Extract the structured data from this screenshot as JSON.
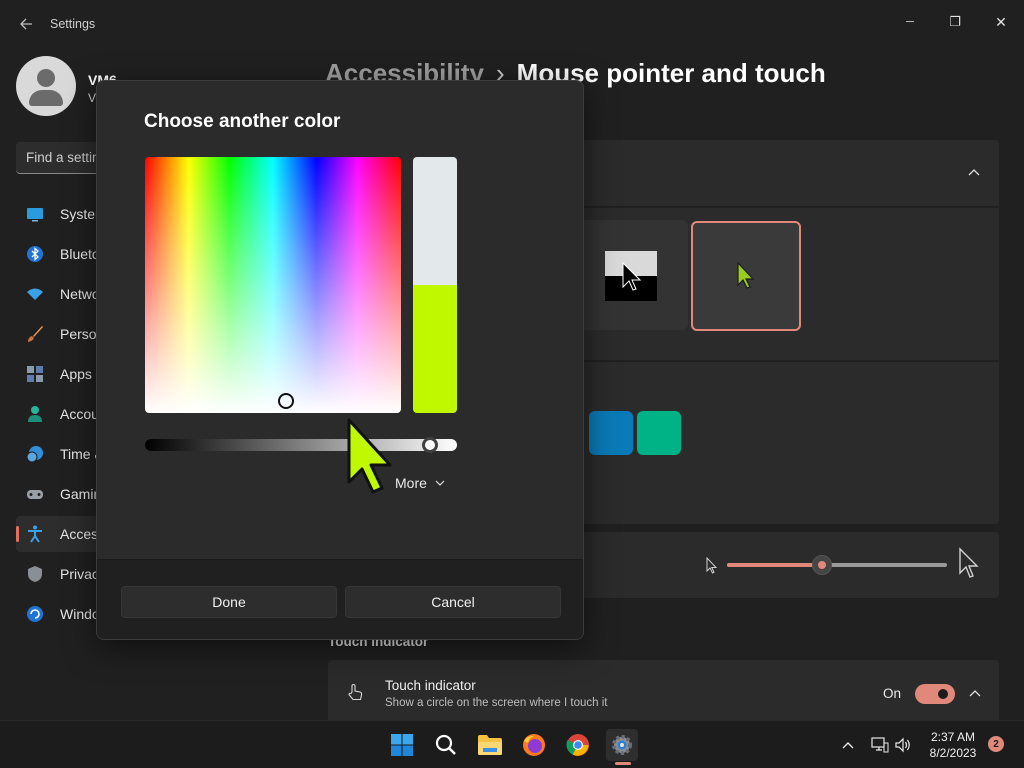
{
  "window": {
    "title": "Settings",
    "controls": {
      "minimize": "─",
      "maximize": "❐",
      "close": "✕"
    }
  },
  "profile": {
    "name": "VM6",
    "subtitle": "V"
  },
  "search": {
    "placeholder": "Find a setting"
  },
  "sidebar": {
    "items": [
      {
        "label": "System",
        "icon": "monitor-icon",
        "active": false
      },
      {
        "label": "Bluetooth & devices",
        "icon": "bluetooth-icon",
        "active": false
      },
      {
        "label": "Network & internet",
        "icon": "wifi-icon",
        "active": false
      },
      {
        "label": "Personalization",
        "icon": "brush-icon",
        "active": false
      },
      {
        "label": "Apps",
        "icon": "apps-icon",
        "active": false
      },
      {
        "label": "Accounts",
        "icon": "person-icon",
        "active": false
      },
      {
        "label": "Time & language",
        "icon": "globe-clock-icon",
        "active": false
      },
      {
        "label": "Gaming",
        "icon": "gamepad-icon",
        "active": false
      },
      {
        "label": "Accessibility",
        "icon": "accessibility-icon",
        "active": true
      },
      {
        "label": "Privacy & security",
        "icon": "shield-icon",
        "active": false
      },
      {
        "label": "Windows Update",
        "icon": "update-icon",
        "active": false
      }
    ]
  },
  "header": {
    "parent": "Accessibility",
    "separator": "›",
    "current": "Mouse pointer and touch"
  },
  "pointer_size": {
    "value_fraction": 0.43
  },
  "touch_section": {
    "title": "Touch indicator",
    "row_title": "Touch indicator",
    "row_desc": "Show a circle on the screen where I touch it",
    "toggle_label": "On",
    "toggle_on": true
  },
  "color_swatches": [
    "#0a7ab8",
    "#00b386"
  ],
  "dialog": {
    "title": "Choose another color",
    "more_label": "More",
    "done_label": "Done",
    "cancel_label": "Cancel",
    "previous_color": "#e3e8ea",
    "new_color": "#c0f800",
    "value_fraction": 0.915
  },
  "taskbar": {
    "apps": [
      "windows-start-icon",
      "search-icon",
      "file-explorer-icon",
      "firefox-icon",
      "chrome-icon",
      "settings-icon"
    ],
    "active_app": "settings-icon",
    "time": "2:37 AM",
    "date": "8/2/2023",
    "notification_count": "2"
  },
  "colors": {
    "accent": "#e0897b",
    "background": "#202020",
    "card": "#2b2b2b",
    "pointer_color": "#c0f800"
  }
}
